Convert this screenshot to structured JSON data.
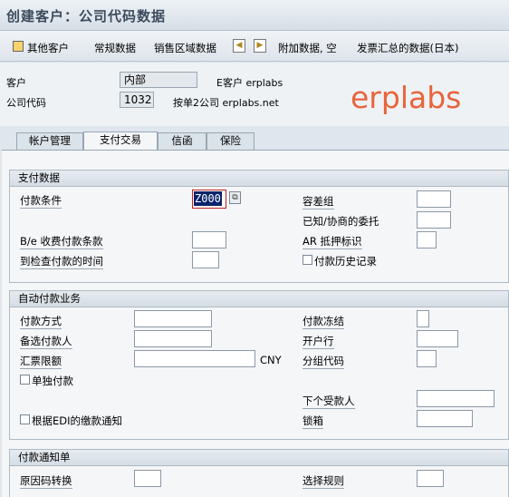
{
  "title": "创建客户：公司代码数据",
  "toolbar": {
    "other_customer": "其他客户",
    "general_data": "常规数据",
    "sales_area_data": "销售区域数据",
    "additional_data": "附加数据, 空",
    "invoice_summary": "发票汇总的数据(日本)"
  },
  "header": {
    "customer_label": "客户",
    "customer_value": "内部",
    "customer_desc": "E客户 erplabs",
    "company_code_label": "公司代码",
    "company_code_value": "1032",
    "company_code_desc": "按单2公司 erplabs.net"
  },
  "watermark": "erplabs",
  "tabs": [
    "帐户管理",
    "支付交易",
    "信函",
    "保险"
  ],
  "payment_data": {
    "heading": "支付数据",
    "terms_label": "付款条件",
    "terms_value": "Z000",
    "tolerance_group": "容差组",
    "known_agreed": "已知/协商的委托",
    "be_terms": "B/e 收费付款条款",
    "ar_pledging": "AR 抵押标识",
    "time_until_check": "到检查付款的时间",
    "payment_history": "付款历史记录"
  },
  "auto_payment": {
    "heading": "自动付款业务",
    "payment_methods": "付款方式",
    "payment_block": "付款冻结",
    "alternative_payer": "备选付款人",
    "house_bank": "开户行",
    "bill_limit": "汇票限额",
    "currency": "CNY",
    "grouping_key": "分组代码",
    "individual_payment": "单独付款",
    "next_payee": "下个受款人",
    "edi_advice": "根据EDI的缴款通知",
    "lockbox": "锁箱"
  },
  "payment_advice": {
    "heading": "付款通知单",
    "reason_code_conversion": "原因码转换",
    "selection_rule": "选择规则"
  }
}
